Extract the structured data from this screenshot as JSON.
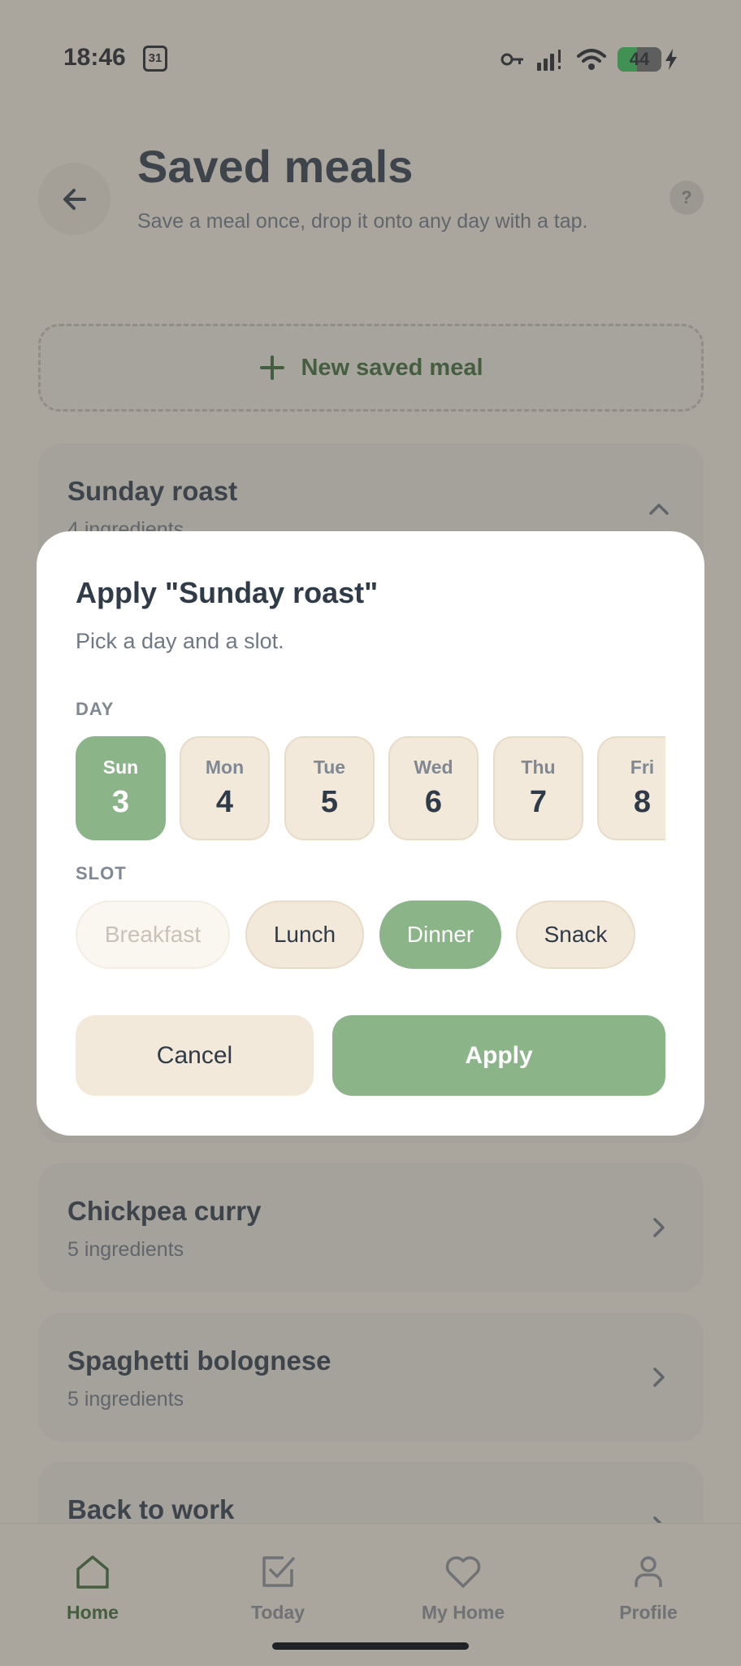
{
  "status_bar": {
    "time": "18:46",
    "calendar_day": "31",
    "battery_level": "44",
    "battery_fraction": 0.44
  },
  "header": {
    "title": "Saved meals",
    "subtitle": "Save a meal once, drop it onto any day with a tap.",
    "help": "?"
  },
  "new_meal_button": {
    "label": "New saved meal"
  },
  "meals": [
    {
      "name": "Sunday roast",
      "count": "4 ingredients"
    },
    {
      "name": "Chickpea curry",
      "count": "5 ingredients"
    },
    {
      "name": "Spaghetti bolognese",
      "count": "5 ingredients"
    },
    {
      "name": "Back to work",
      "count": ""
    }
  ],
  "dialog": {
    "title": "Apply \"Sunday roast\"",
    "subtitle": "Pick a day and a slot.",
    "day_label": "DAY",
    "slot_label": "SLOT",
    "days": [
      {
        "name": "Sun",
        "num": "3"
      },
      {
        "name": "Mon",
        "num": "4"
      },
      {
        "name": "Tue",
        "num": "5"
      },
      {
        "name": "Wed",
        "num": "6"
      },
      {
        "name": "Thu",
        "num": "7"
      },
      {
        "name": "Fri",
        "num": "8"
      }
    ],
    "selected_day": "Sun",
    "slots": [
      "Breakfast",
      "Lunch",
      "Dinner",
      "Snack"
    ],
    "selected_slot": "Dinner",
    "disabled_slot": "Breakfast",
    "cancel_label": "Cancel",
    "apply_label": "Apply"
  },
  "nav": {
    "items": [
      {
        "label": "Home",
        "icon": "home-icon",
        "active": true
      },
      {
        "label": "Today",
        "icon": "checkbox-icon",
        "active": false
      },
      {
        "label": "My Home",
        "icon": "heart-icon",
        "active": false
      },
      {
        "label": "Profile",
        "icon": "person-icon",
        "active": false
      }
    ]
  },
  "colors": {
    "background": "#f4eddd",
    "accent_green": "#8bb489",
    "text_dark": "#2f3b48",
    "brand_green_text": "#3c6a33",
    "chip_beige": "#f3e9da"
  }
}
